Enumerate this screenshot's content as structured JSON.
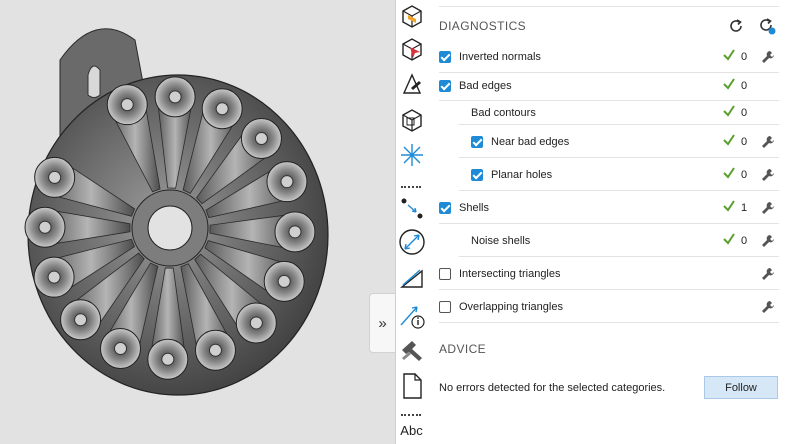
{
  "viewport": {
    "collapse_glyph": "»",
    "model_icon": "turbine-model-render"
  },
  "toolstrip": {
    "tools": [
      "box-open-icon",
      "box-arrow-icon",
      "triangle-pen-icon",
      "box-cube-icon",
      "star-axis-icon",
      "points-arrow-icon",
      "circle-measure-icon",
      "triangle-measure-icon",
      "measure-info-icon",
      "hammer-icon",
      "page-icon",
      "abc-text-icon"
    ],
    "abc_label": "Abc"
  },
  "diagnostics": {
    "title": "DIAGNOSTICS",
    "refresh_icon": "refresh-icon",
    "auto_refresh_icon": "auto-refresh-icon",
    "rows": [
      {
        "label": "Inverted normals",
        "checked": true,
        "indent": 0,
        "ok": true,
        "count": "0",
        "wrench": true
      },
      {
        "label": "Bad edges",
        "checked": true,
        "indent": 0,
        "ok": true,
        "count": "0",
        "wrench": false
      },
      {
        "label": "Bad contours",
        "checkbox": false,
        "indent": 1,
        "ok": true,
        "count": "0",
        "wrench": false
      },
      {
        "label": "Near bad edges",
        "checked": true,
        "indent": 1,
        "ok": true,
        "count": "0",
        "wrench": true
      },
      {
        "label": "Planar holes",
        "checked": true,
        "indent": 1,
        "ok": true,
        "count": "0",
        "wrench": true
      },
      {
        "label": "Shells",
        "checked": true,
        "indent": 0,
        "ok": true,
        "count": "1",
        "wrench": true
      },
      {
        "label": "Noise shells",
        "checkbox": false,
        "indent": 1,
        "ok": true,
        "count": "0",
        "wrench": true
      },
      {
        "label": "Intersecting triangles",
        "checked": false,
        "indent": 0,
        "ok": false,
        "count": "",
        "wrench": true
      },
      {
        "label": "Overlapping triangles",
        "checked": false,
        "indent": 0,
        "ok": false,
        "count": "",
        "wrench": true
      }
    ]
  },
  "advice": {
    "title": "ADVICE",
    "message": "No errors detected for the selected categories.",
    "follow_label": "Follow"
  },
  "colors": {
    "accent": "#1f8bd6",
    "ok_green": "#5aa02c",
    "follow_bg": "#d6e8f7",
    "viewport_bg": "#e2e2e2"
  }
}
